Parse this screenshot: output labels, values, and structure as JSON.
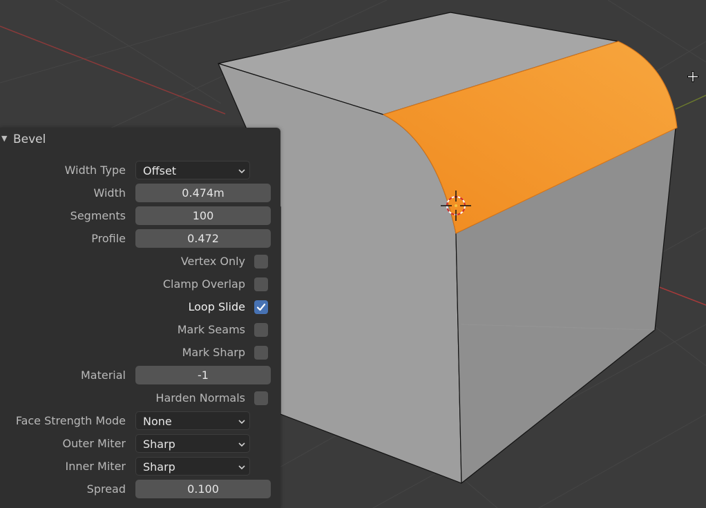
{
  "operator_panel": {
    "title": "Bevel",
    "fields": {
      "width_type": {
        "label": "Width Type",
        "value": "Offset"
      },
      "width": {
        "label": "Width",
        "value": "0.474m"
      },
      "segments": {
        "label": "Segments",
        "value": "100"
      },
      "profile": {
        "label": "Profile",
        "value": "0.472"
      },
      "vertex_only": {
        "label": "Vertex Only",
        "checked": false
      },
      "clamp_overlap": {
        "label": "Clamp Overlap",
        "checked": false
      },
      "loop_slide": {
        "label": "Loop Slide",
        "checked": true
      },
      "mark_seams": {
        "label": "Mark Seams",
        "checked": false
      },
      "mark_sharp": {
        "label": "Mark Sharp",
        "checked": false
      },
      "material": {
        "label": "Material",
        "value": "-1"
      },
      "harden_normals": {
        "label": "Harden Normals",
        "checked": false
      },
      "face_strength_mode": {
        "label": "Face Strength Mode",
        "value": "None"
      },
      "outer_miter": {
        "label": "Outer Miter",
        "value": "Sharp"
      },
      "inner_miter": {
        "label": "Inner Miter",
        "value": "Sharp"
      },
      "spread": {
        "label": "Spread",
        "value": "0.100"
      }
    }
  },
  "colors": {
    "viewport_bg": "#3a3a3a",
    "panel_bg": "#2f2f2f",
    "selected_face": "#f39a2e",
    "cube_face": "#9c9c9c",
    "checkbox_on": "#4772b3"
  },
  "icons": [
    "collapse-triangle-icon",
    "chevron-down-icon",
    "checkmark-icon",
    "3d-cursor-icon",
    "crosshair-cursor-icon"
  ]
}
